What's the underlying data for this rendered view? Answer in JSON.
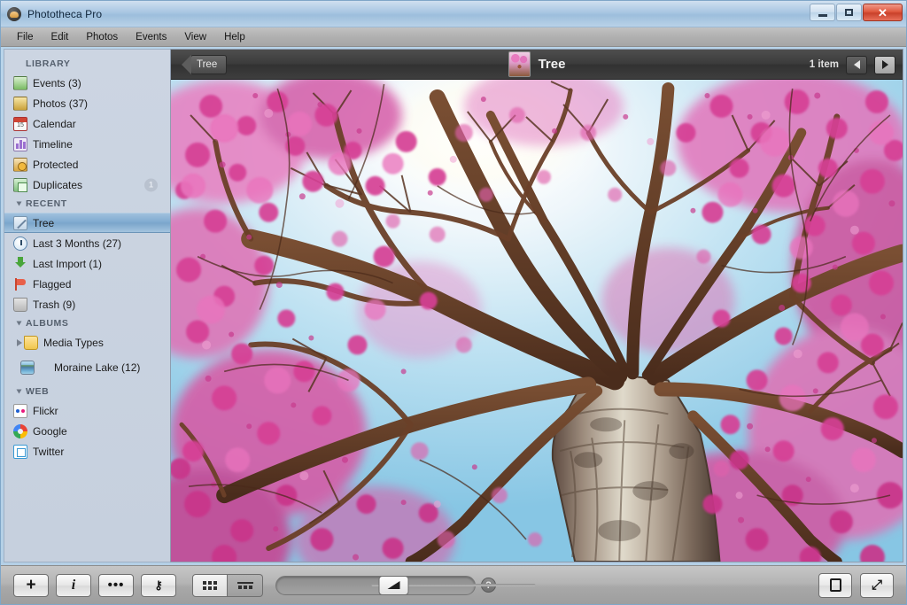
{
  "window": {
    "app_title": "Phototheca Pro",
    "app_icon": "photo-app-icon",
    "controls": {
      "minimize": "minimize-icon",
      "maximize": "maximize-icon",
      "close": "✕"
    }
  },
  "menubar": {
    "items": [
      {
        "label": "File"
      },
      {
        "label": "Edit"
      },
      {
        "label": "Photos"
      },
      {
        "label": "Events"
      },
      {
        "label": "View"
      },
      {
        "label": "Help"
      }
    ]
  },
  "sidebar": {
    "sections": [
      {
        "title": "LIBRARY",
        "collapsible": false,
        "items": [
          {
            "label": "Events (3)",
            "icon": "events-icon"
          },
          {
            "label": "Photos (37)",
            "icon": "photos-icon"
          },
          {
            "label": "Calendar",
            "icon": "calendar-icon"
          },
          {
            "label": "Timeline",
            "icon": "timeline-icon"
          },
          {
            "label": "Protected",
            "icon": "protected-icon"
          },
          {
            "label": "Duplicates",
            "icon": "duplicates-icon",
            "badge": "1"
          }
        ]
      },
      {
        "title": "RECENT",
        "collapsible": true,
        "items": [
          {
            "label": "Tree",
            "icon": "tree-note-icon",
            "selected": true
          },
          {
            "label": "Last 3 Months (27)",
            "icon": "clock-icon"
          },
          {
            "label": "Last Import (1)",
            "icon": "import-icon"
          },
          {
            "label": "Flagged",
            "icon": "flag-icon"
          },
          {
            "label": "Trash (9)",
            "icon": "trash-icon"
          }
        ]
      },
      {
        "title": "ALBUMS",
        "collapsible": true,
        "items": [
          {
            "label": "Media Types",
            "icon": "folder-icon",
            "disclosure": true
          },
          {
            "label": "Moraine Lake (12)",
            "icon": "lake-thumbnail"
          }
        ]
      },
      {
        "title": "WEB",
        "collapsible": true,
        "items": [
          {
            "label": "Flickr",
            "icon": "flickr-icon"
          },
          {
            "label": "Google",
            "icon": "google-icon"
          },
          {
            "label": "Twitter",
            "icon": "twitter-icon"
          }
        ]
      }
    ]
  },
  "main_toolbar": {
    "back_label": "Tree",
    "thumbnail": "tree-thumbnail",
    "title": "Tree",
    "item_count": "1 item",
    "prev_icon": "arrow-left-icon",
    "next_icon": "arrow-right-icon"
  },
  "photo": {
    "alt": "cherry-blossom-tree-viewed-from-below",
    "sky_color": "#9fd4ec",
    "blossom_color": "#d94fa0",
    "bark_color": "#6e4a33"
  },
  "bottombar": {
    "buttons": [
      {
        "name": "add-button",
        "glyph": "+"
      },
      {
        "name": "info-button",
        "glyph": "i"
      },
      {
        "name": "more-button",
        "glyph": "•••"
      },
      {
        "name": "key-button",
        "glyph": "⚷"
      }
    ],
    "view_modes": [
      {
        "name": "grid-view",
        "selected": true
      },
      {
        "name": "list-view",
        "selected": false
      }
    ],
    "search_placeholder": "",
    "search_value": "",
    "help_glyph": "?",
    "zoom_level": 10,
    "right_buttons": [
      {
        "name": "single-photo-view-button",
        "glyph": "▭"
      },
      {
        "name": "fullscreen-button",
        "glyph": "⤢"
      }
    ]
  }
}
